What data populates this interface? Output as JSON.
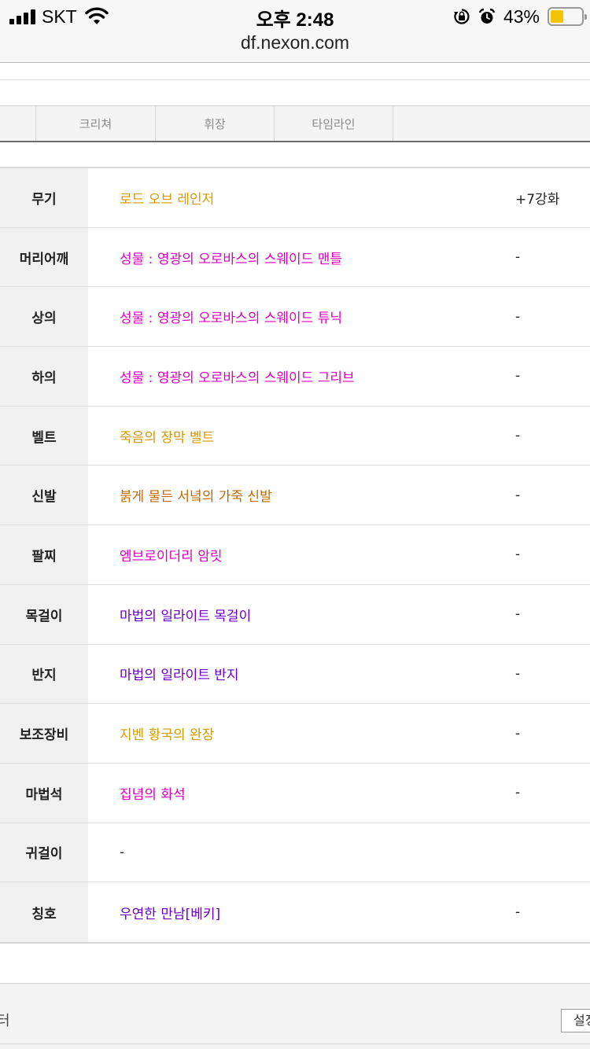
{
  "status_bar": {
    "carrier": "SKT",
    "time": "오후 2:48",
    "url": "df.nexon.com",
    "battery_percent": "43%",
    "battery_level": 0.43,
    "icons": [
      "signal-icon",
      "wifi-icon",
      "orientation-lock-icon",
      "alarm-icon",
      "battery-icon"
    ]
  },
  "tabs": [
    {
      "label": "크리쳐"
    },
    {
      "label": "휘장"
    },
    {
      "label": "타임라인"
    }
  ],
  "equipment": [
    {
      "slot": "무기",
      "item": "로드 오브 레인저",
      "item_color": "#d49a00",
      "upgrade": "+7강화"
    },
    {
      "slot": "머리어깨",
      "item": "성물 : 영광의 오로바스의 스웨이드 맨틀",
      "item_color": "#e000c0",
      "upgrade": "-"
    },
    {
      "slot": "상의",
      "item": "성물 : 영광의 오로바스의 스웨이드 튜닉",
      "item_color": "#e000c0",
      "upgrade": "-"
    },
    {
      "slot": "하의",
      "item": "성물 : 영광의 오로바스의 스웨이드 그리브",
      "item_color": "#e000c0",
      "upgrade": "-"
    },
    {
      "slot": "벨트",
      "item": "죽음의 장막 벨트",
      "item_color": "#d49a00",
      "upgrade": "-"
    },
    {
      "slot": "신발",
      "item": "붉게 물든 서녘의 가죽 신발",
      "item_color": "#c06a00",
      "upgrade": "-"
    },
    {
      "slot": "팔찌",
      "item": "엠브로이더리 암릿",
      "item_color": "#e000c0",
      "upgrade": "-"
    },
    {
      "slot": "목걸이",
      "item": "마법의 일라이트 목걸이",
      "item_color": "#6a00c8",
      "upgrade": "-"
    },
    {
      "slot": "반지",
      "item": "마법의 일라이트 반지",
      "item_color": "#6a00c8",
      "upgrade": "-"
    },
    {
      "slot": "보조장비",
      "item": "지벤 황국의 완장",
      "item_color": "#d49a00",
      "upgrade": "-"
    },
    {
      "slot": "마법석",
      "item": "집념의 화석",
      "item_color": "#e000c0",
      "upgrade": "-"
    },
    {
      "slot": "귀걸이",
      "item": "-",
      "item_color": "#222222",
      "upgrade": ""
    },
    {
      "slot": "칭호",
      "item": "우연한 만남[베키]",
      "item_color": "#6a00c8",
      "upgrade": "-"
    }
  ],
  "footer": {
    "label": "터",
    "button_label": "설정"
  }
}
